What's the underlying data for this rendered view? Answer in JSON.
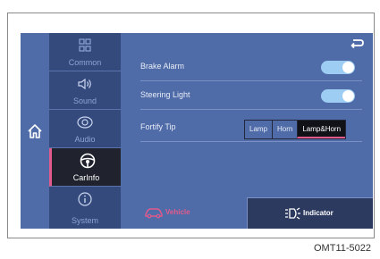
{
  "sidebar": {
    "items": [
      {
        "label": "Common",
        "icon": "grid-icon",
        "active": false
      },
      {
        "label": "Sound",
        "icon": "speaker-icon",
        "active": false
      },
      {
        "label": "Audio",
        "icon": "audio-icon",
        "active": false
      },
      {
        "label": "CarInfo",
        "icon": "steering-wheel-icon",
        "active": true
      },
      {
        "label": "System",
        "icon": "info-icon",
        "active": false
      }
    ]
  },
  "settings": {
    "brake_alarm": {
      "label": "Brake Alarm",
      "on": true
    },
    "steering_light": {
      "label": "Steering Light",
      "on": true
    },
    "fortify_tip": {
      "label": "Fortify Tip",
      "options": [
        "Lamp",
        "Horn",
        "Lamp&Horn"
      ],
      "selected": "Lamp&Horn"
    }
  },
  "tabs": {
    "vehicle": {
      "label": "Vehicle",
      "active": false
    },
    "indicator": {
      "label": "Indicator",
      "active": true
    }
  },
  "caption": "OMT11-5022",
  "colors": {
    "background": "#4f6ca9",
    "sidebar": "#34497c",
    "active_item": "#20232d",
    "accent": "#e25a8c",
    "toggle_on": "#9ecdf4"
  }
}
